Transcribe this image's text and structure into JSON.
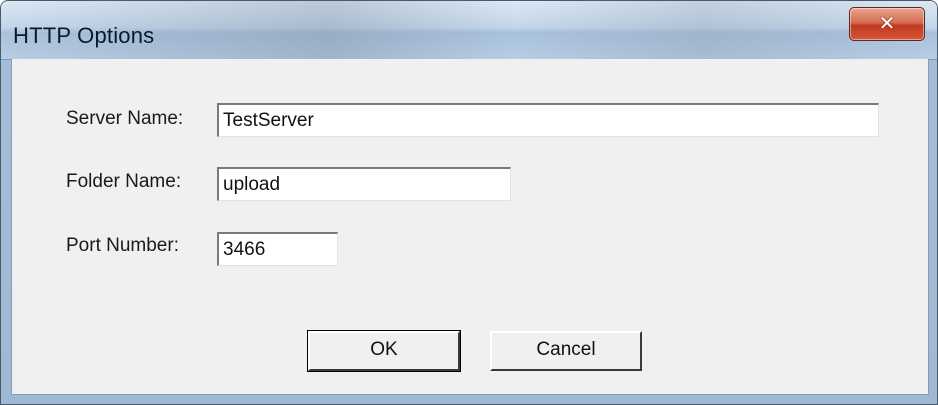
{
  "window": {
    "title": "HTTP Options",
    "close_icon": "close-x-icon"
  },
  "form": {
    "server_name_label": "Server Name:",
    "server_name_value": "TestServer",
    "folder_name_label": "Folder Name:",
    "folder_name_value": "upload",
    "port_number_label": "Port Number:",
    "port_number_value": "3466"
  },
  "buttons": {
    "ok_label": "OK",
    "cancel_label": "Cancel"
  },
  "colors": {
    "titlebar": "#b9d1ea",
    "close_button": "#c13a1f",
    "client_background": "#f0f0f0"
  }
}
